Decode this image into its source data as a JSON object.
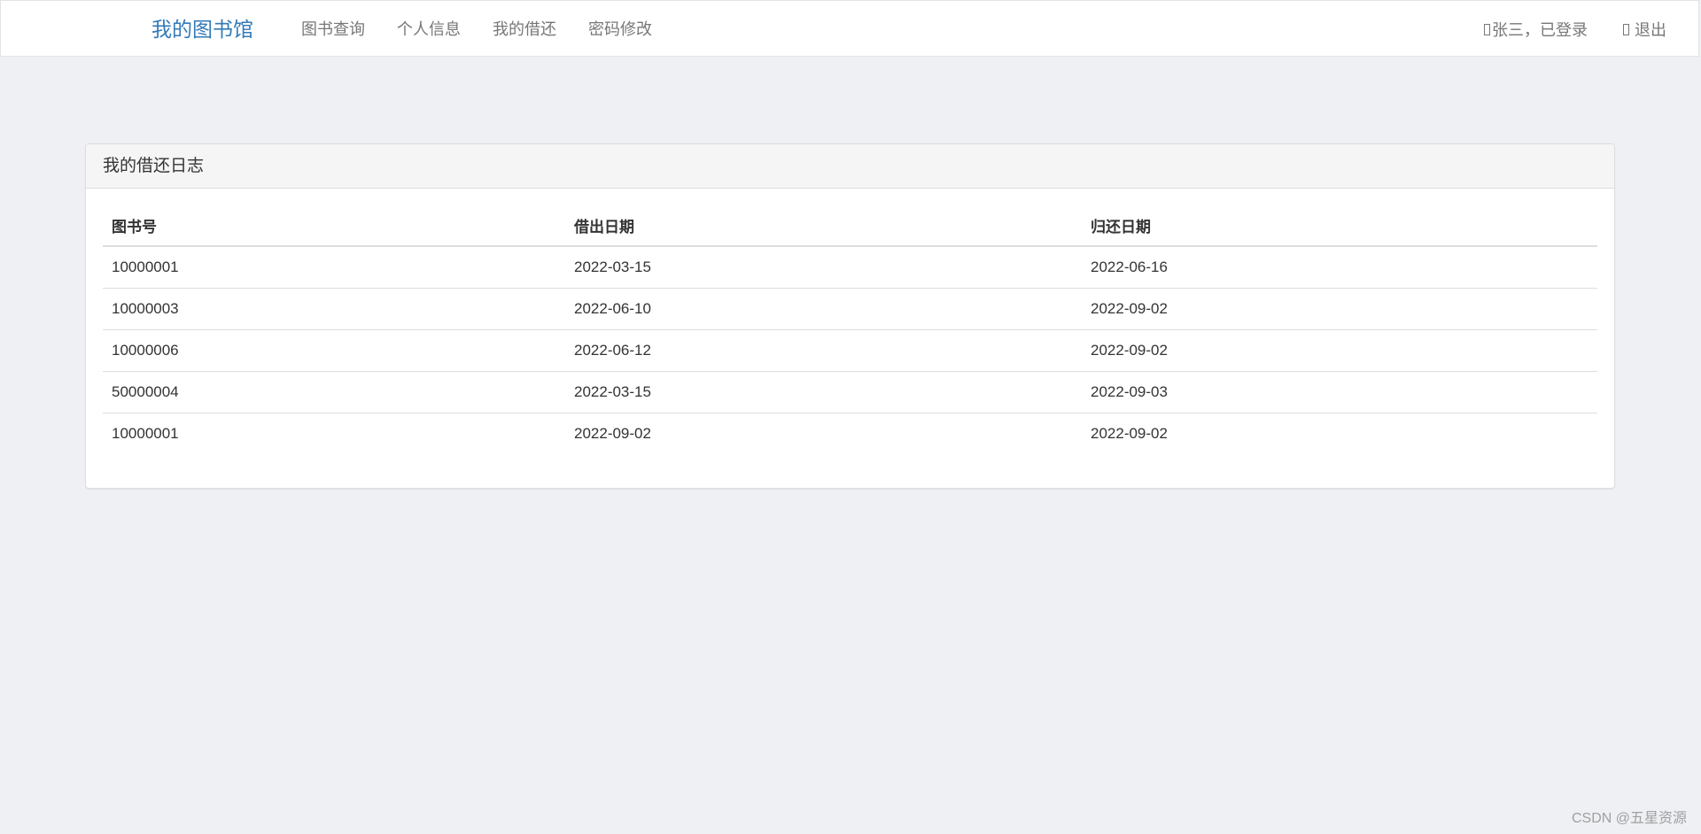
{
  "navbar": {
    "brand": "我的图书馆",
    "items": [
      {
        "label": "图书查询"
      },
      {
        "label": "个人信息"
      },
      {
        "label": "我的借还"
      },
      {
        "label": "密码修改"
      }
    ],
    "user_status": "张三，已登录",
    "logout": "退出"
  },
  "panel": {
    "title": "我的借还日志",
    "columns": [
      "图书号",
      "借出日期",
      "归还日期"
    ],
    "rows": [
      [
        "10000001",
        "2022-03-15",
        "2022-06-16"
      ],
      [
        "10000003",
        "2022-06-10",
        "2022-09-02"
      ],
      [
        "10000006",
        "2022-06-12",
        "2022-09-02"
      ],
      [
        "50000004",
        "2022-03-15",
        "2022-09-03"
      ],
      [
        "10000001",
        "2022-09-02",
        "2022-09-02"
      ]
    ]
  },
  "watermark": "CSDN @五星资源",
  "colors": {
    "brand": "#337ab7",
    "background": "#eff0f4"
  }
}
